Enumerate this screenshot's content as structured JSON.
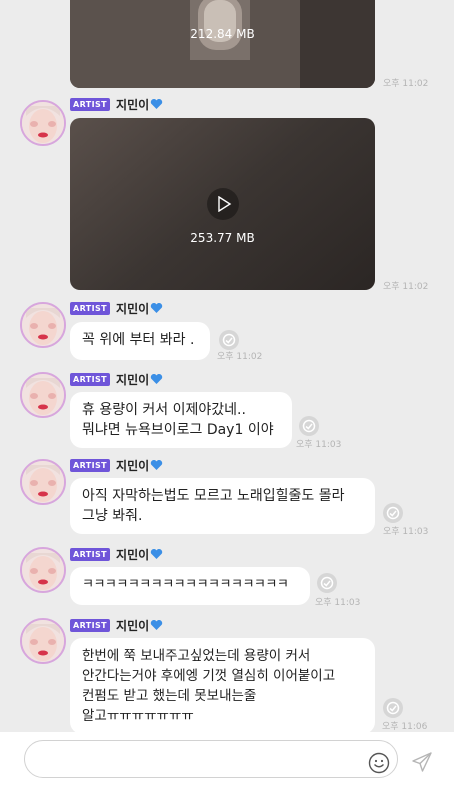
{
  "artist_badge": "ARTIST",
  "sender_name": "지민이",
  "messages": {
    "video1": {
      "size": "212.84 MB",
      "time": "오후 11:02"
    },
    "video2": {
      "size": "253.77 MB",
      "time": "오후 11:02"
    },
    "msg1": {
      "lines": [
        "꼭 위에 부터 봐라 ."
      ],
      "time": "오후 11:02"
    },
    "msg2": {
      "lines": [
        "휴 용량이 커서 이제야갔네..",
        "뭐냐면 뉴욕브이로그 Day1 이야"
      ],
      "time": "오후 11:03"
    },
    "msg3": {
      "lines": [
        "아직 자막하는법도 모르고 노래입힐줄도 몰라",
        "그냥 봐줘."
      ],
      "time": "오후 11:03"
    },
    "msg4": {
      "lines": [
        "ㅋㅋㅋㅋㅋㅋㅋㅋㅋㅋㅋㅋㅋㅋㅋㅋㅋㅋ"
      ],
      "time": "오후 11:03"
    },
    "msg5": {
      "lines": [
        "한번에 쭉 보내주고싶었는데 용량이 커서",
        "안간다는거야 후에엥 기껏 열심히 이어붙이고",
        "컨펌도 받고 했는데 못보내는줄",
        "알고ㅠㅠㅠㅠㅠㅠㅠ"
      ],
      "time": "오후 11:06"
    }
  },
  "composer": {
    "placeholder": ""
  },
  "colors": {
    "badge": "#6f55d9",
    "heart": "#3b8fe6",
    "avatar_ring": "#d7a6dd"
  },
  "icons": [
    "heart-icon",
    "play-icon",
    "read-status-icon",
    "emoji-icon",
    "send-icon"
  ]
}
